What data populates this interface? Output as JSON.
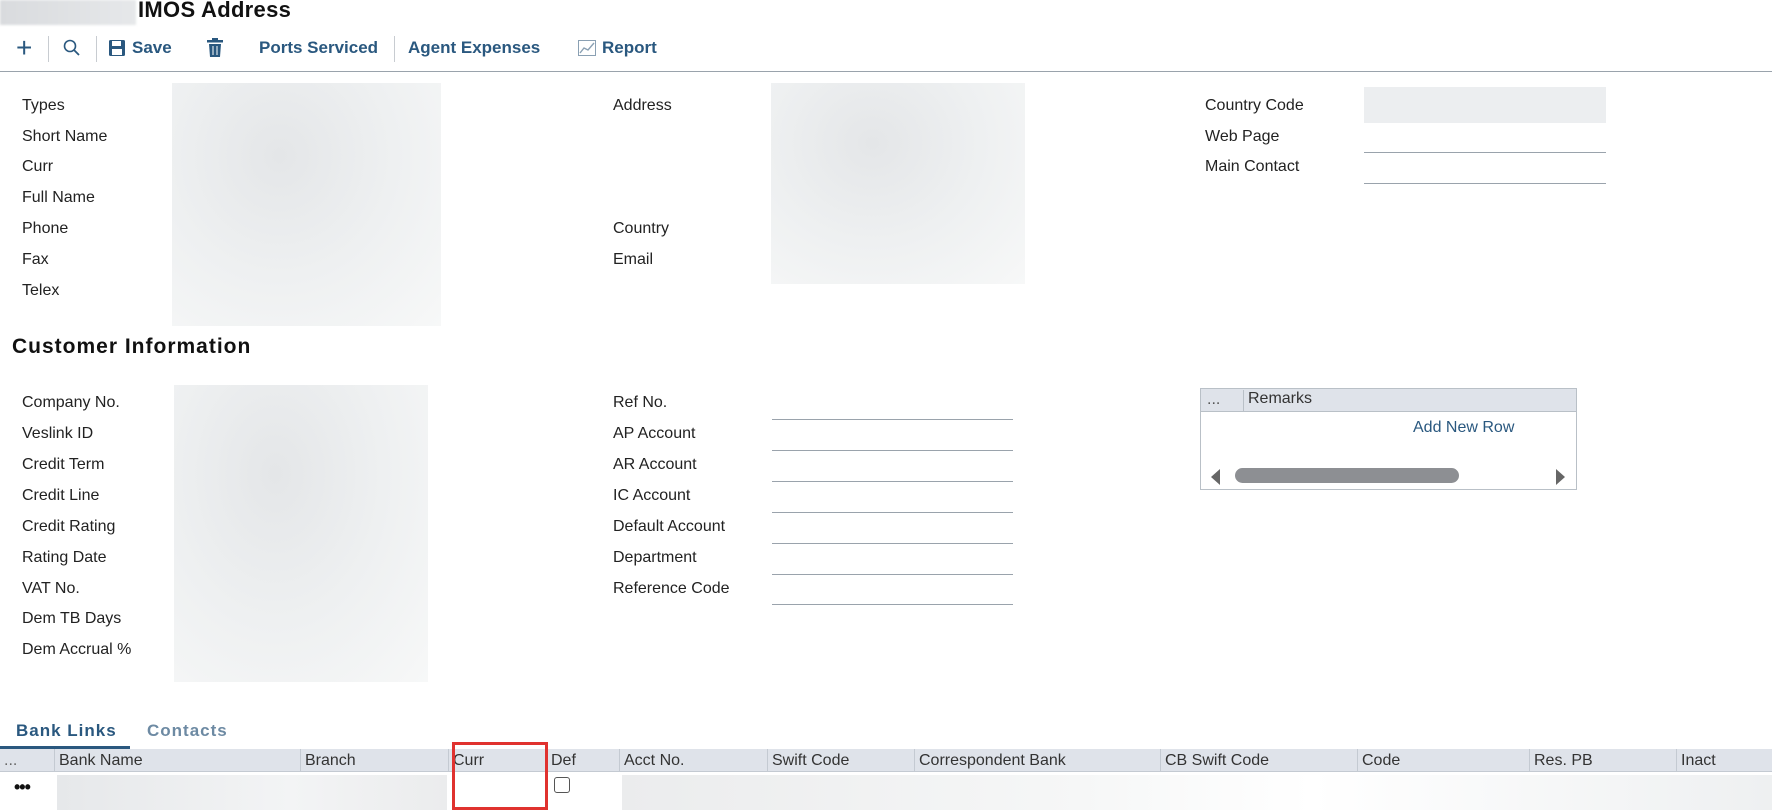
{
  "app": {
    "title": "IMOS Address"
  },
  "toolbar": {
    "save_label": "Save",
    "ports_serviced_label": "Ports Serviced",
    "agent_expenses_label": "Agent Expenses",
    "report_label": "Report",
    "icons": [
      "plus-icon",
      "search-icon",
      "save-icon",
      "trash-icon",
      "chart-icon"
    ]
  },
  "address_fields": {
    "col1": [
      "Types",
      "Short Name",
      "Curr",
      "Full Name",
      "Phone",
      "Fax",
      "Telex"
    ],
    "col2": {
      "address": "Address",
      "country": "Country",
      "email": "Email"
    },
    "col3": [
      "Country Code",
      "Web Page",
      "Main Contact"
    ]
  },
  "customer_info": {
    "title": "Customer Information",
    "col1": [
      "Company No.",
      "Veslink ID",
      "Credit Term",
      "Credit Line",
      "Credit Rating",
      "Rating Date",
      "VAT No.",
      "Dem TB Days",
      "Dem Accrual %"
    ],
    "col2": [
      "Ref No.",
      "AP Account",
      "AR Account",
      "IC Account",
      "Default Account",
      "Department",
      "Reference Code"
    ]
  },
  "remarks_grid": {
    "dots": "...",
    "column": "Remarks",
    "add_row_label": "Add New Row"
  },
  "tabs": [
    {
      "label": "Bank Links",
      "active": true
    },
    {
      "label": "Contacts",
      "active": false
    }
  ],
  "bank_grid": {
    "dots_header": "...",
    "columns": [
      "Bank Name",
      "Branch",
      "Curr",
      "Def",
      "Acct No.",
      "Swift Code",
      "Correspondent Bank",
      "CB Swift Code",
      "Code",
      "Res. PB",
      "Inact"
    ],
    "row_menu": "•••"
  },
  "colors": {
    "accent": "#2a587f",
    "highlight": "#e0322f",
    "grid_header": "#dfe3ea"
  }
}
